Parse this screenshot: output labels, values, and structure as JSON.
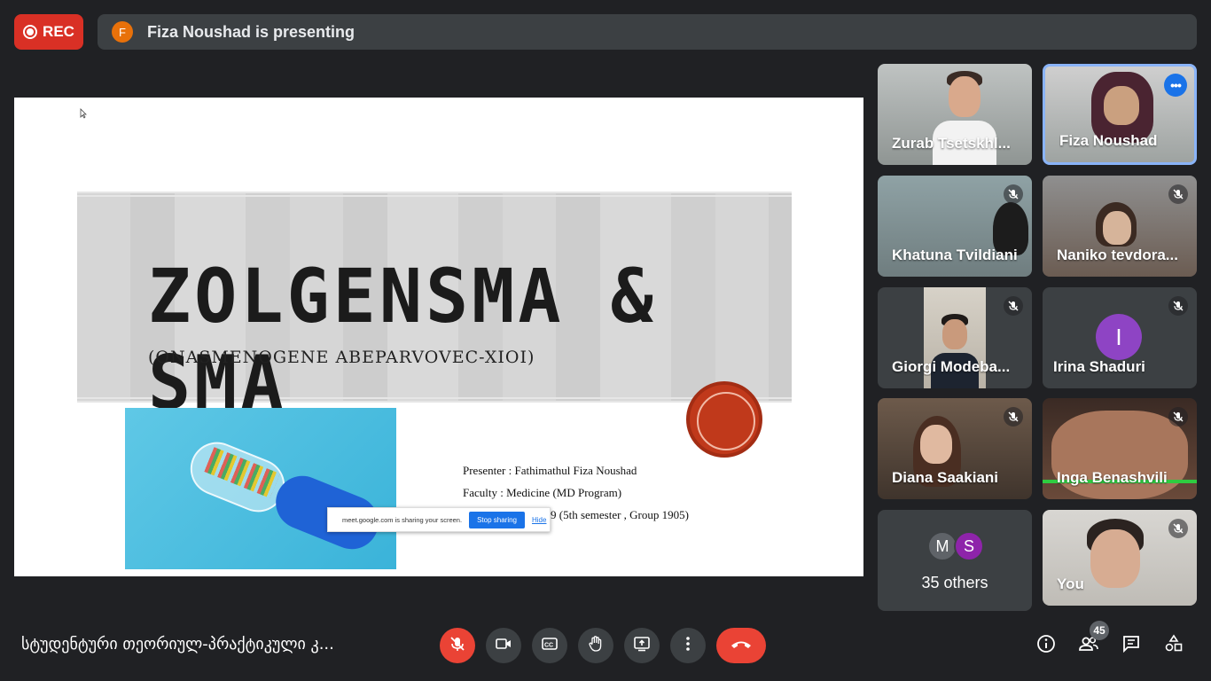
{
  "rec": {
    "label": "REC"
  },
  "presenter_bar": {
    "avatar_letter": "F",
    "text": "Fiza Noushad is presenting"
  },
  "slide": {
    "title": "ZOLGENSMA & SMA",
    "subtitle": "(ONASMENOGENE ABEPARVOVEC-XIOI)",
    "lines": [
      "Presenter : Fathimathul Fiza Noushad",
      "Faculty : Medicine (MD Program)",
      "9 (5th semester , Group 1905)"
    ],
    "share_notice": {
      "text": "meet.google.com is sharing your screen.",
      "stop_label": "Stop sharing",
      "hide_label": "Hide"
    }
  },
  "participants": [
    {
      "name": "Zurab Tsetskhl...",
      "muted": false
    },
    {
      "name": "Fiza Noushad",
      "muted": false,
      "active": true
    },
    {
      "name": "Khatuna Tvildiani",
      "muted": true
    },
    {
      "name": "Naniko tevdora...",
      "muted": true
    },
    {
      "name": "Giorgi Modeba...",
      "muted": true
    },
    {
      "name": "Irina Shaduri",
      "muted": true,
      "avatar_letter": "I"
    },
    {
      "name": "Diana Saakiani",
      "muted": true
    },
    {
      "name": "Inga Benashvili",
      "muted": true
    },
    {
      "name": "You",
      "muted": true
    }
  ],
  "others": {
    "letters": [
      "M",
      "S"
    ],
    "label": "35 others"
  },
  "footer": {
    "meeting_title": "სტუდენტური თეორიულ-პრაქტიკული კ...",
    "participant_count": "45"
  },
  "colors": {
    "background": "#202124",
    "tile": "#3c4043",
    "rec": "#d93025",
    "end_call": "#ea4335",
    "accent": "#1a73e8"
  }
}
